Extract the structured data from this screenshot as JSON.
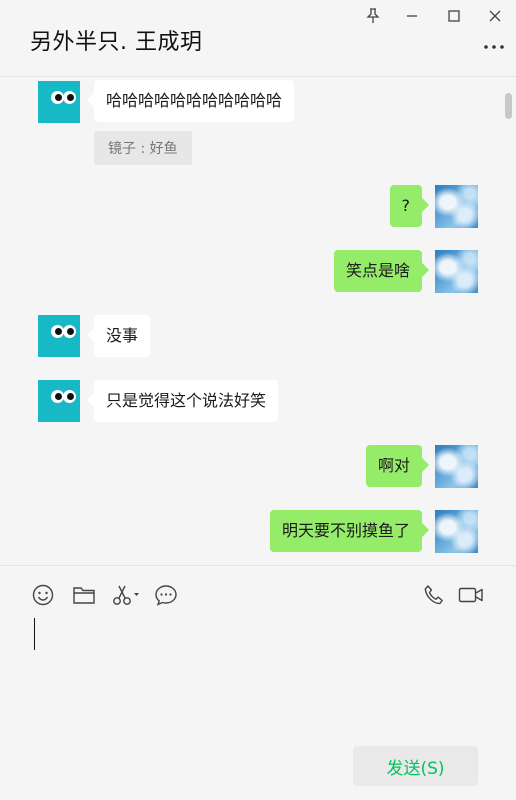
{
  "window": {
    "title": "另外半只. 王成玥",
    "controls": [
      "pin-icon",
      "minimize-icon",
      "maximize-icon",
      "close-icon"
    ],
    "more_icon": "more-dots-icon"
  },
  "messages": [
    {
      "side": "left",
      "avatar": "bot-avatar",
      "text": "哈哈哈哈哈哈哈哈哈哈哈",
      "quote": "镜子 : 好鱼"
    },
    {
      "side": "right",
      "avatar": "sky-avatar",
      "text": "?"
    },
    {
      "side": "right",
      "avatar": "sky-avatar",
      "text": "笑点是啥"
    },
    {
      "side": "left",
      "avatar": "bot-avatar",
      "text": "没事"
    },
    {
      "side": "left",
      "avatar": "bot-avatar",
      "text": "只是觉得这个说法好笑"
    },
    {
      "side": "right",
      "avatar": "sky-avatar",
      "text": "啊对"
    },
    {
      "side": "right",
      "avatar": "sky-avatar",
      "text": "明天要不别摸鱼了"
    }
  ],
  "toolbar": {
    "icons": [
      "emoji-icon",
      "folder-icon",
      "scissors-icon",
      "chat-history-icon",
      "phone-call-icon",
      "video-call-icon"
    ]
  },
  "input": {
    "value": ""
  },
  "send_button": {
    "label": "发送(S)"
  },
  "colors": {
    "background": "#f5f5f5",
    "bubble_self": "#95ec69",
    "bubble_other": "#ffffff",
    "bot_avatar": "#17b9c6",
    "send_text": "#07c160"
  }
}
